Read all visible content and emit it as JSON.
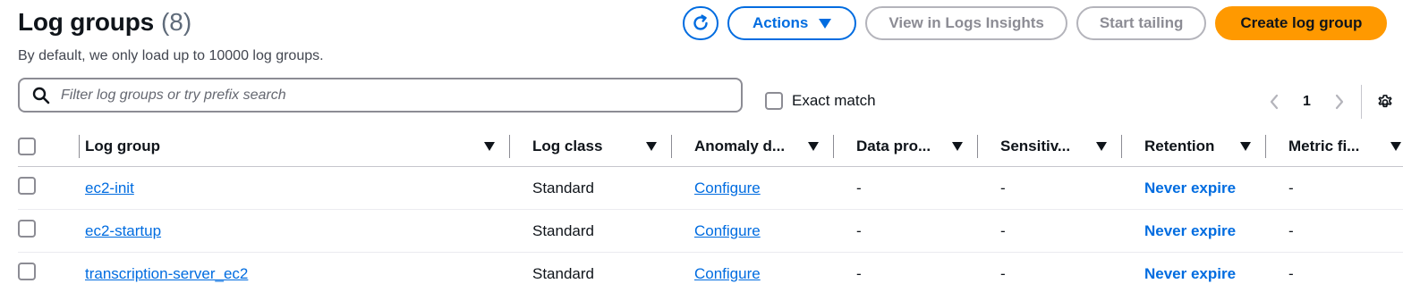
{
  "header": {
    "title": "Log groups",
    "count": "(8)",
    "subtitle": "By default, we only load up to 10000 log groups."
  },
  "toolbar": {
    "refresh_icon": "refresh-icon",
    "actions_label": "Actions",
    "view_insights_label": "View in Logs Insights",
    "start_tailing_label": "Start tailing",
    "create_label": "Create log group"
  },
  "search": {
    "placeholder": "Filter log groups or try prefix search",
    "value": ""
  },
  "exact_match": {
    "label": "Exact match",
    "checked": false
  },
  "pagination": {
    "current_page": "1"
  },
  "table": {
    "columns": [
      "Log group",
      "Log class",
      "Anomaly d...",
      "Data pro...",
      "Sensitiv...",
      "Retention",
      "Metric fi..."
    ],
    "rows": [
      {
        "log_group": "ec2-init",
        "log_class": "Standard",
        "anomaly": "Configure",
        "data_protection": "-",
        "sensitive": "-",
        "retention": "Never expire",
        "metric_filters": "-"
      },
      {
        "log_group": "ec2-startup",
        "log_class": "Standard",
        "anomaly": "Configure",
        "data_protection": "-",
        "sensitive": "-",
        "retention": "Never expire",
        "metric_filters": "-"
      },
      {
        "log_group": "transcription-server_ec2",
        "log_class": "Standard",
        "anomaly": "Configure",
        "data_protection": "-",
        "sensitive": "-",
        "retention": "Never expire",
        "metric_filters": "-"
      }
    ]
  },
  "colors": {
    "link": "#006ce0",
    "primary_button": "#ff9900",
    "disabled_text": "#8c8c94"
  }
}
